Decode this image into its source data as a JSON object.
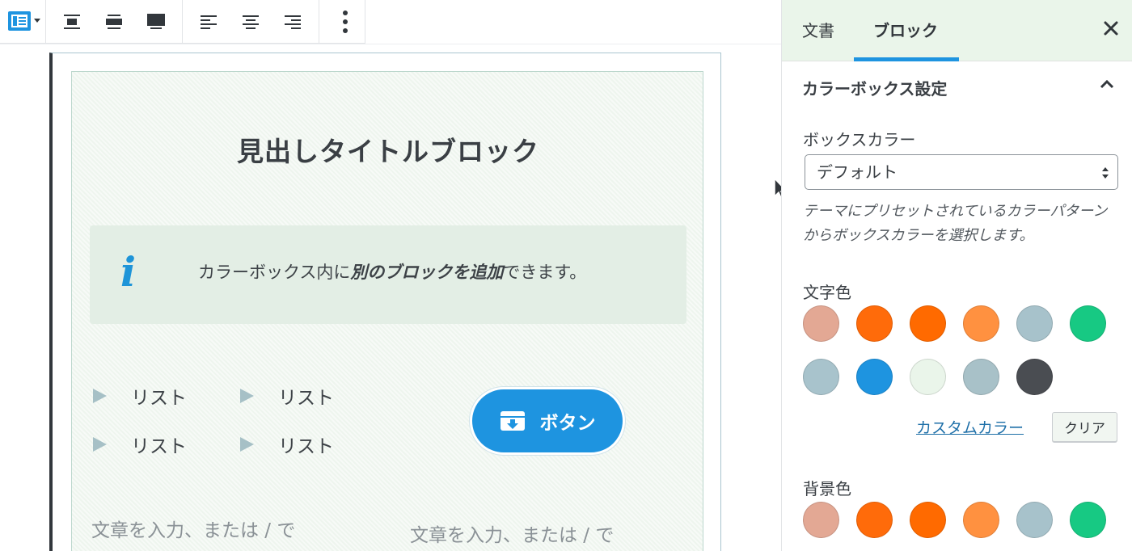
{
  "toolbar": {
    "buttons": [
      {
        "name": "block-type-icon"
      },
      {
        "name": "align-wide-center-icon"
      },
      {
        "name": "align-wide-icon"
      },
      {
        "name": "align-full-icon"
      },
      {
        "name": "text-align-left-icon"
      },
      {
        "name": "text-align-center-icon"
      },
      {
        "name": "text-align-right-icon"
      },
      {
        "name": "more-options-icon"
      }
    ]
  },
  "editor": {
    "heading": "見出しタイトルブロック",
    "info": {
      "icon": "i",
      "text_before": "カラーボックス内に",
      "text_emphasis": "別のブロックを追加",
      "text_after": "できます。"
    },
    "list_items": [
      "リスト",
      "リスト",
      "リスト",
      "リスト"
    ],
    "button_label": "ボタン",
    "paragraph_placeholder_left": "文章を入力、または / で",
    "paragraph_placeholder_right": "文章を入力、または / で"
  },
  "sidebar": {
    "tabs": [
      "文書",
      "ブロック"
    ],
    "active_tab": "ブロック",
    "section_title": "カラーボックス設定",
    "box_color_label": "ボックスカラー",
    "box_color_value": "デフォルト",
    "help_text": "テーマにプリセットされているカラーパターンからボックスカラーを選択します。",
    "text_color_label": "文字色",
    "text_colors": [
      "#e3a894",
      "#ff6b0a",
      "#ff6a00",
      "#ff9140",
      "#a7c2cb",
      "#17c983",
      "#a8c3cc",
      "#1e94e0",
      "#eaf5ea",
      "#a8c1c8",
      "#4a4d52"
    ],
    "custom_color_link": "カスタムカラー",
    "clear_button": "クリア",
    "background_color_label": "背景色",
    "background_colors": [
      "#e3a894",
      "#ff6b0a",
      "#ff6a00",
      "#ff9140",
      "#a7c2cb",
      "#17c983"
    ]
  }
}
